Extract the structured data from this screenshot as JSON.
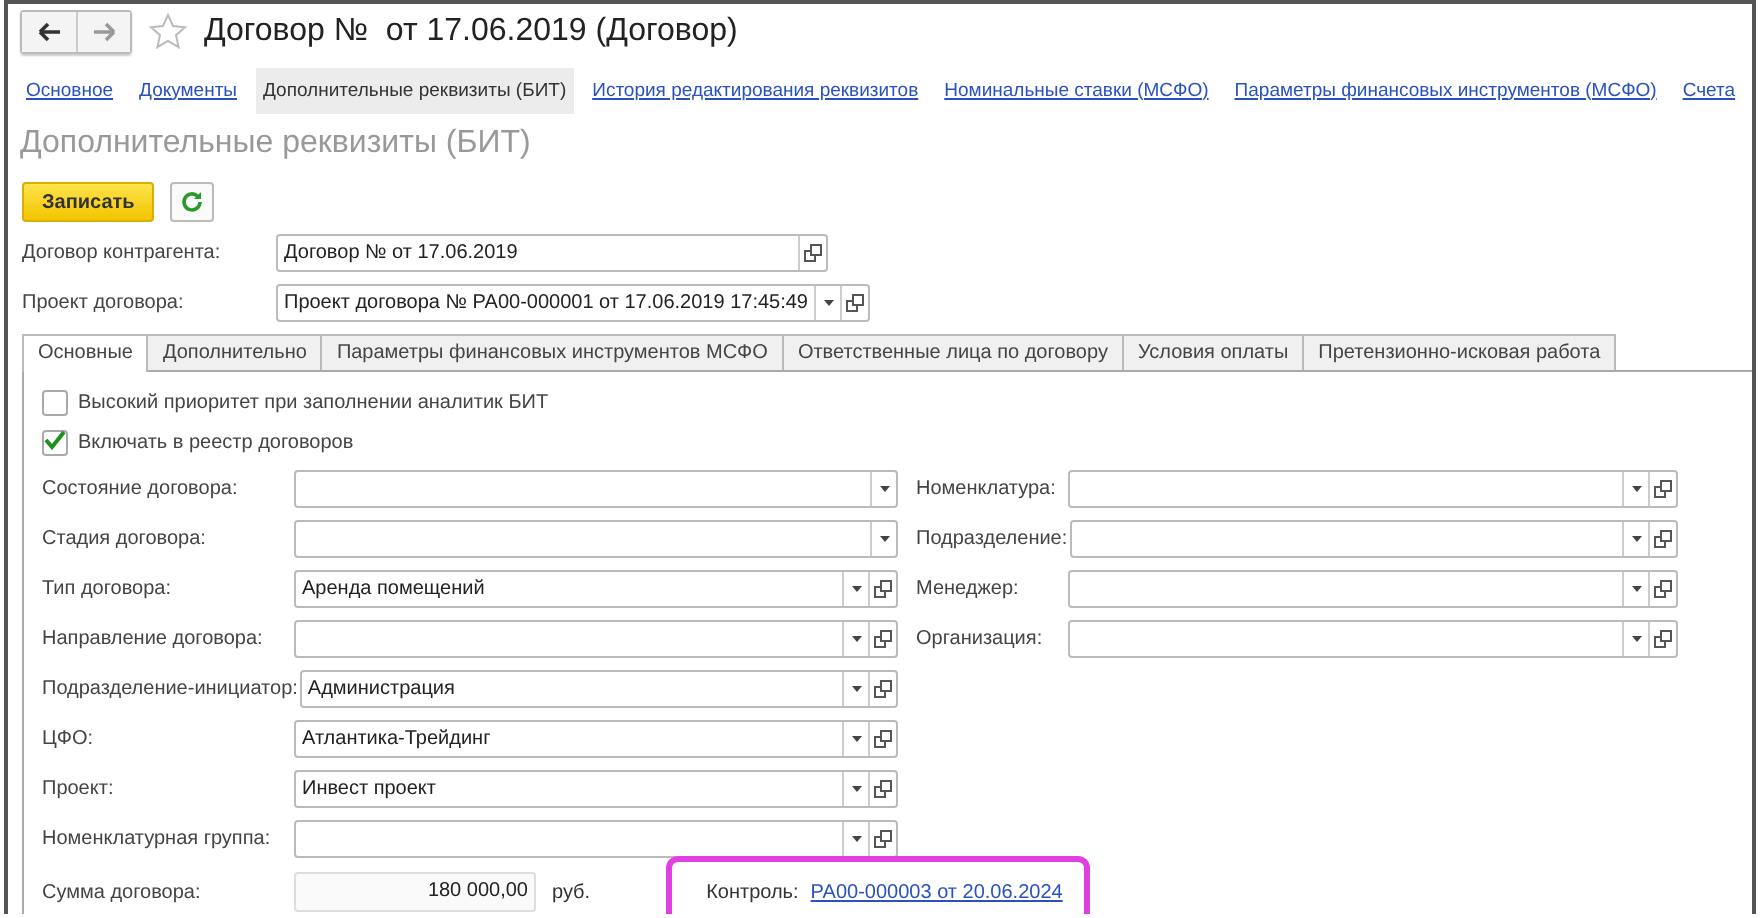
{
  "window": {
    "title": "Договор №  от 17.06.2019 (Договор)",
    "favorite": false
  },
  "nav_links": [
    {
      "label": "Основное",
      "selected": false
    },
    {
      "label": "Документы",
      "selected": false
    },
    {
      "label": "Дополнительные реквизиты (БИТ)",
      "selected": true
    },
    {
      "label": "История редактирования реквизитов",
      "selected": false
    },
    {
      "label": "Номинальные ставки (МСФО)",
      "selected": false
    },
    {
      "label": "Параметры финансовых инструментов (МСФО)",
      "selected": false
    },
    {
      "label": "Счета",
      "selected": false
    }
  ],
  "section_title": "Дополнительные реквизиты (БИТ)",
  "toolbar": {
    "save_button": "Записать"
  },
  "header_fields": [
    {
      "label": "Договор контрагента:",
      "value": "Договор №  от 17.06.2019",
      "kind": "ref"
    },
    {
      "label": "Проект договора:",
      "value": "Проект договора № РА00-000001 от 17.06.2019 17:45:49",
      "kind": "select-ref"
    }
  ],
  "tabs": [
    {
      "label": "Основные",
      "selected": true
    },
    {
      "label": "Дополнительно",
      "selected": false
    },
    {
      "label": "Параметры финансовых инструментов МСФО",
      "selected": false
    },
    {
      "label": "Ответственные лица по договору",
      "selected": false
    },
    {
      "label": "Условия оплаты",
      "selected": false
    },
    {
      "label": "Претензионно-исковая работа",
      "selected": false
    }
  ],
  "checkboxes": [
    {
      "label": "Высокий приоритет при заполнении аналитик БИТ",
      "checked": false
    },
    {
      "label": "Включать в реестр договоров",
      "checked": true
    }
  ],
  "left_fields": [
    {
      "label": "Состояние договора:",
      "kind": "select"
    },
    {
      "label": "Стадия договора:",
      "kind": "select"
    },
    {
      "label": "Тип договора:",
      "value": "Аренда помещений",
      "kind": "select-ref"
    },
    {
      "label": "Направление договора:",
      "kind": "select-ref"
    },
    {
      "label": "Подразделение-инициатор:",
      "value": "Администрация",
      "kind": "select-ref"
    },
    {
      "label": "ЦФО:",
      "value": "Атлантика-Трейдинг",
      "kind": "select-ref"
    },
    {
      "label": "Проект:",
      "value": "Инвест проект",
      "kind": "select-ref"
    },
    {
      "label": "Номенклатурная группа:",
      "kind": "select-ref"
    }
  ],
  "right_fields": [
    {
      "label": "Номенклатура:",
      "kind": "select-ref"
    },
    {
      "label": "Подразделение:",
      "kind": "select-ref"
    },
    {
      "label": "Менеджер:",
      "kind": "select-ref"
    },
    {
      "label": "Организация:",
      "kind": "select-ref"
    }
  ],
  "sum": {
    "label": "Сумма договора:",
    "value": "180 000,00",
    "unit": "руб."
  },
  "control": {
    "label": "Контроль:",
    "link": "РА00-000003 от 20.06.2024",
    "highlighted": true
  }
}
